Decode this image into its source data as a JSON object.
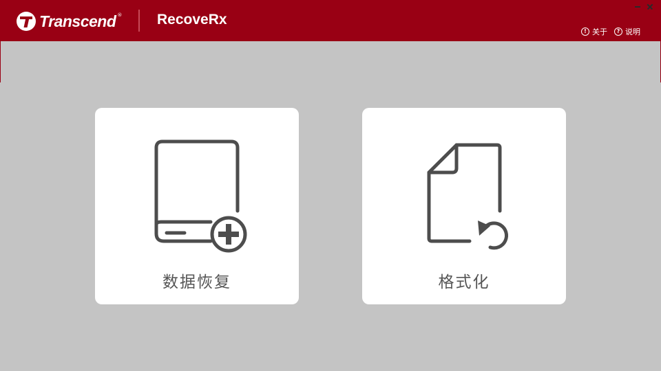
{
  "header": {
    "brand": "Transcend",
    "brand_mark": "®",
    "app_title": "RecoveRx",
    "links": {
      "about": "关于",
      "help": "说明"
    },
    "background": "#990014"
  },
  "window_controls": {
    "minimize_icon": "minimize-icon",
    "close_icon": "close-icon"
  },
  "cards": {
    "recover": {
      "label": "数据恢复",
      "icon": "drive-add-icon"
    },
    "format": {
      "label": "格式化",
      "icon": "document-restore-icon"
    }
  },
  "colors": {
    "accent": "#990014",
    "background": "#c4c4c4",
    "card": "#ffffff",
    "icon": "#4d4d4d"
  }
}
